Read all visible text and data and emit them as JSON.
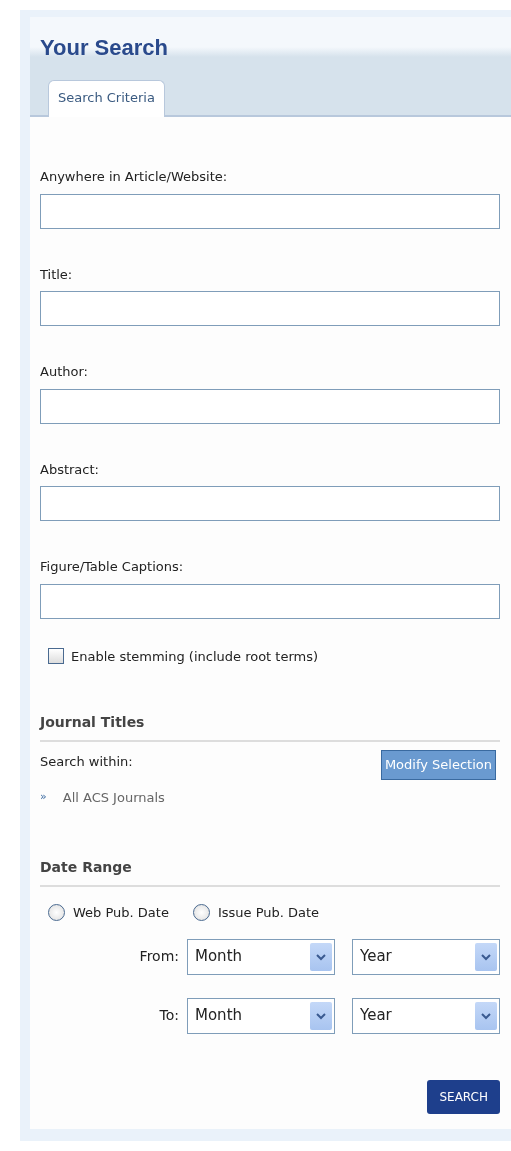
{
  "panel": {
    "title": "Your Search"
  },
  "tabs": [
    {
      "label": "Search Criteria",
      "selected": true
    }
  ],
  "fields": [
    {
      "label": "Anywhere in Article/Website:"
    },
    {
      "label": "Title:"
    },
    {
      "label": "Author:"
    },
    {
      "label": "Abstract:"
    },
    {
      "label": "Figure/Table Captions:"
    }
  ],
  "stemming": {
    "label": "Enable stemming (include root terms)",
    "checked": false
  },
  "journal_titles": {
    "heading": "Journal Titles",
    "search_within": "Search within:",
    "button": "Modify Selection",
    "selection_marker": "»",
    "selection": "All ACS Journals"
  },
  "date_range": {
    "heading": "Date Range",
    "options": [
      {
        "label": "Web Pub. Date",
        "selected": false
      },
      {
        "label": "Issue Pub. Date",
        "selected": false
      }
    ],
    "rows": [
      {
        "label": "From:",
        "month": "Month",
        "year": "Year"
      },
      {
        "label": "To:",
        "month": "Month",
        "year": "Year"
      }
    ]
  },
  "search_button": "SEARCH"
}
